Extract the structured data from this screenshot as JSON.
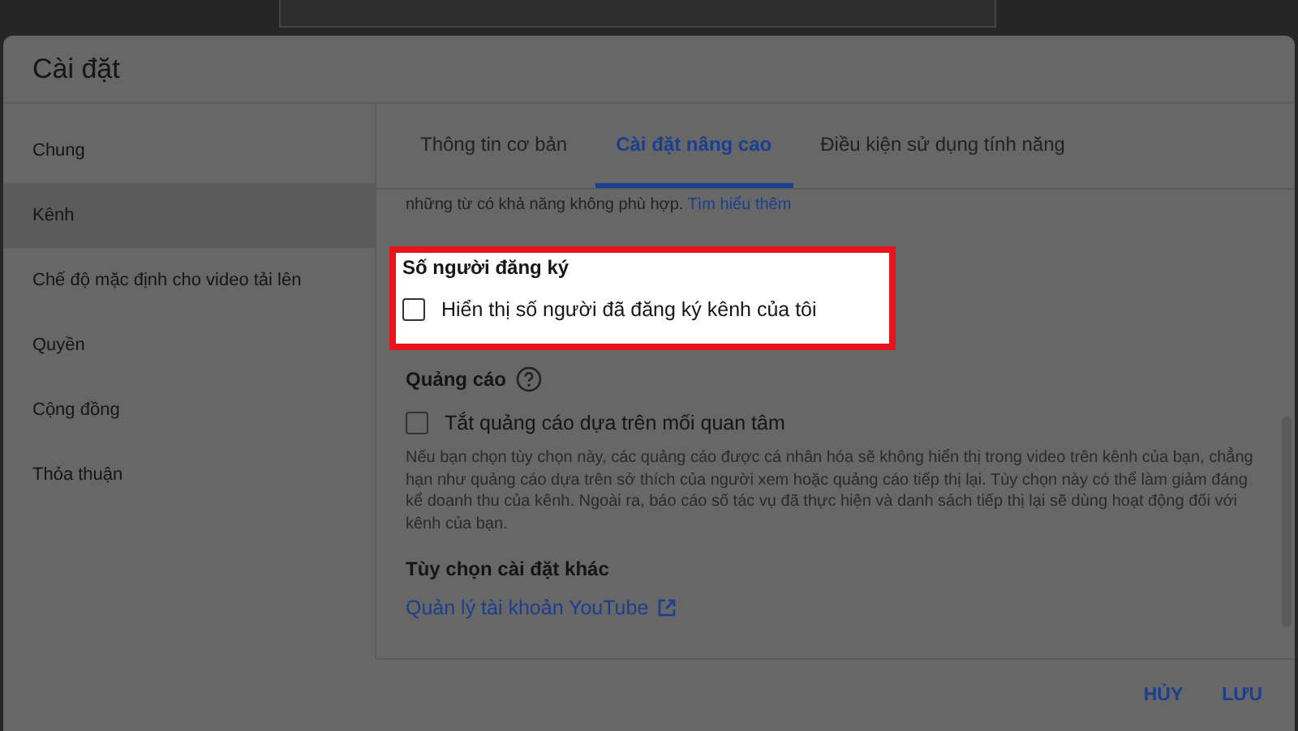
{
  "window": {
    "title": "Cài đặt"
  },
  "sidebar": {
    "items": [
      {
        "label": "Chung",
        "selected": false
      },
      {
        "label": "Kênh",
        "selected": true
      },
      {
        "label": "Chế độ mặc định cho video tải lên",
        "selected": false
      },
      {
        "label": "Quyền",
        "selected": false
      },
      {
        "label": "Cộng đồng",
        "selected": false
      },
      {
        "label": "Thỏa thuận",
        "selected": false
      }
    ]
  },
  "tabs": [
    {
      "label": "Thông tin cơ bản",
      "selected": false
    },
    {
      "label": "Cài đặt nâng cao",
      "selected": true
    },
    {
      "label": "Điều kiện sử dụng tính năng",
      "selected": false
    }
  ],
  "content": {
    "intro": {
      "text": "những từ có khả năng không phù hợp.",
      "link": "Tìm hiểu thêm"
    },
    "sections": [
      {
        "title": "Số người đăng ký",
        "kind": "plain",
        "highlighted": true,
        "items": [
          {
            "kind": "checkbox",
            "label": "Hiển thị số người đã đăng ký kênh của tôi",
            "checked": false
          }
        ]
      },
      {
        "title": "Quảng cáo",
        "kind": "help",
        "highlighted": false,
        "items": [
          {
            "kind": "checkbox",
            "label": "Tắt quảng cáo dựa trên mối quan tâm",
            "checked": false
          },
          {
            "kind": "note",
            "text": "Nếu bạn chọn tùy chọn này, các quảng cáo được cá nhân hóa sẽ không hiển thị trong video trên kênh của bạn, chẳng hạn như quảng cáo dựa trên sở thích của người xem hoặc quảng cáo tiếp thị lại. Tùy chọn này có thể làm giảm đáng kể doanh thu của kênh. Ngoài ra, báo cáo số tác vụ đã thực hiện và danh sách tiếp thị lại sẽ dùng hoạt động đối với kênh của bạn."
          }
        ]
      },
      {
        "title": "Tùy chọn cài đặt khác",
        "kind": "plain",
        "highlighted": false,
        "items": [
          {
            "kind": "link",
            "label": "Quản lý tài khoản YouTube"
          }
        ]
      }
    ]
  },
  "buttons": [
    "HỦY",
    "LƯU"
  ]
}
